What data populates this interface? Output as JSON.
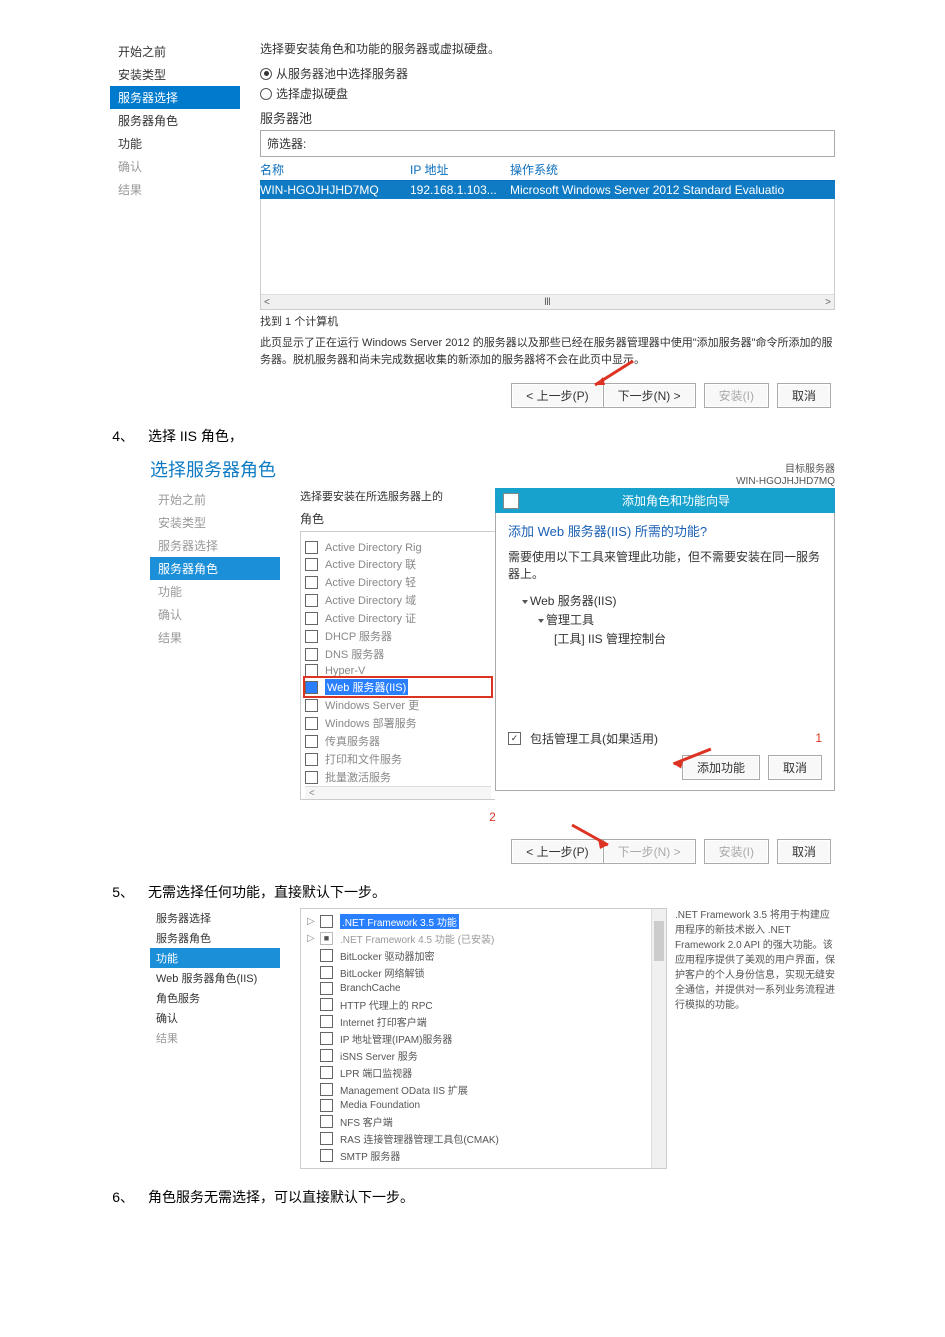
{
  "screenshot1": {
    "sidebar": {
      "items": [
        {
          "label": "开始之前",
          "state": "done"
        },
        {
          "label": "安装类型",
          "state": "done"
        },
        {
          "label": "服务器选择",
          "state": "current"
        },
        {
          "label": "服务器角色",
          "state": "done"
        },
        {
          "label": "功能",
          "state": "done"
        },
        {
          "label": "确认",
          "state": "disabled"
        },
        {
          "label": "结果",
          "state": "disabled"
        }
      ]
    },
    "instr": "选择要安装角色和功能的服务器或虚拟硬盘。",
    "radio1": "从服务器池中选择服务器",
    "radio2": "选择虚拟硬盘",
    "pool_label": "服务器池",
    "filter_label": "筛选器:",
    "filter_value": "",
    "th_name": "名称",
    "th_ip": "IP 地址",
    "th_os": "操作系统",
    "row": {
      "name": "WIN-HGOJHJHD7MQ",
      "ip": "192.168.1.103...",
      "os": "Microsoft Windows Server 2012 Standard Evaluatio"
    },
    "scroll_left": "<",
    "scroll_mid": "Ⅲ",
    "scroll_right": ">",
    "found": "找到 1 个计算机",
    "note": "此页显示了正在运行 Windows Server 2012 的服务器以及那些已经在服务器管理器中使用\"添加服务器\"命令所添加的服务器。脱机服务器和尚未完成数据收集的新添加的服务器将不会在此页中显示。",
    "btn_prev": "< 上一步(P)",
    "btn_next": "下一步(N) >",
    "btn_install": "安装(I)",
    "btn_cancel": "取消"
  },
  "step4_num": "4、",
  "step4_text": "选择 IIS 角色，",
  "screenshot2": {
    "dialog_title": "选择服务器角色",
    "dest_label": "目标服务器",
    "dest_name": "WIN-HGOJHJHD7MQ",
    "sidebar": {
      "items": [
        {
          "label": "开始之前",
          "state": "disabled"
        },
        {
          "label": "安装类型",
          "state": "disabled"
        },
        {
          "label": "服务器选择",
          "state": "disabled"
        },
        {
          "label": "服务器角色",
          "state": "current"
        },
        {
          "label": "功能",
          "state": "disabled"
        },
        {
          "label": "确认",
          "state": "disabled"
        },
        {
          "label": "结果",
          "state": "disabled"
        }
      ]
    },
    "instr": "选择要安装在所选服务器上的",
    "roles_label": "角色",
    "roles": [
      "Active Directory Rig",
      "Active Directory 联",
      "Active Directory 轻",
      "Active Directory 域",
      "Active Directory 证",
      "DHCP 服务器",
      "DNS 服务器",
      "Hyper-V",
      "Web 服务器(IIS)",
      "Windows Server 更",
      "Windows 部署服务",
      "传真服务器",
      "打印和文件服务",
      "批量激活服务"
    ],
    "scroll_left": "<",
    "popup_title": "添加角色和功能向导",
    "popup_q": "添加 Web 服务器(IIS) 所需的功能?",
    "popup_note": "需要使用以下工具来管理此功能，但不需要安装在同一服务器上。",
    "tree": {
      "l1": "Web 服务器(IIS)",
      "l2": "管理工具",
      "l3": "[工具] IIS 管理控制台"
    },
    "include_label": "包括管理工具(如果适用)",
    "btn_add": "添加功能",
    "btn_cancel": "取消",
    "num1": "1",
    "num2": "2",
    "btn_prev": "< 上一步(P)",
    "btn_next": "下一步(N) >",
    "btn_install": "安装(I)",
    "btn_cancel2": "取消"
  },
  "step5_num": "5、",
  "step5_text": "无需选择任何功能，直接默认下一步。",
  "screenshot3": {
    "sidebar": {
      "items": [
        {
          "label": "服务器选择"
        },
        {
          "label": "服务器角色"
        },
        {
          "label": "功能",
          "current": true
        },
        {
          "label": "Web 服务器角色(IIS)"
        },
        {
          "label": "角色服务"
        },
        {
          "label": "确认"
        },
        {
          "label": "结果"
        }
      ]
    },
    "features": [
      {
        "expand": "▷",
        "hl": true,
        "label": ".NET Framework 3.5 功能"
      },
      {
        "expand": "▷",
        "disabled": true,
        "label": ".NET Framework 4.5 功能 (已安装)"
      },
      {
        "label": "BitLocker 驱动器加密"
      },
      {
        "label": "BitLocker 网络解锁"
      },
      {
        "label": "BranchCache"
      },
      {
        "label": "HTTP 代理上的 RPC"
      },
      {
        "label": "Internet 打印客户端"
      },
      {
        "label": "IP 地址管理(IPAM)服务器"
      },
      {
        "label": "iSNS Server 服务"
      },
      {
        "label": "LPR 端口监视器"
      },
      {
        "label": "Management OData IIS 扩展"
      },
      {
        "label": "Media Foundation"
      },
      {
        "label": "NFS 客户端"
      },
      {
        "label": "RAS 连接管理器管理工具包(CMAK)"
      },
      {
        "label": "SMTP 服务器"
      }
    ],
    "desc": ".NET Framework 3.5 将用于构建应用程序的新技术嵌入 .NET Framework 2.0 API 的强大功能。该应用程序提供了美观的用户界面，保护客户的个人身份信息，实现无缝安全通信，并提供对一系列业务流程进行模拟的功能。"
  },
  "step6_num": "6、",
  "step6_text": "角色服务无需选择，可以直接默认下一步。"
}
